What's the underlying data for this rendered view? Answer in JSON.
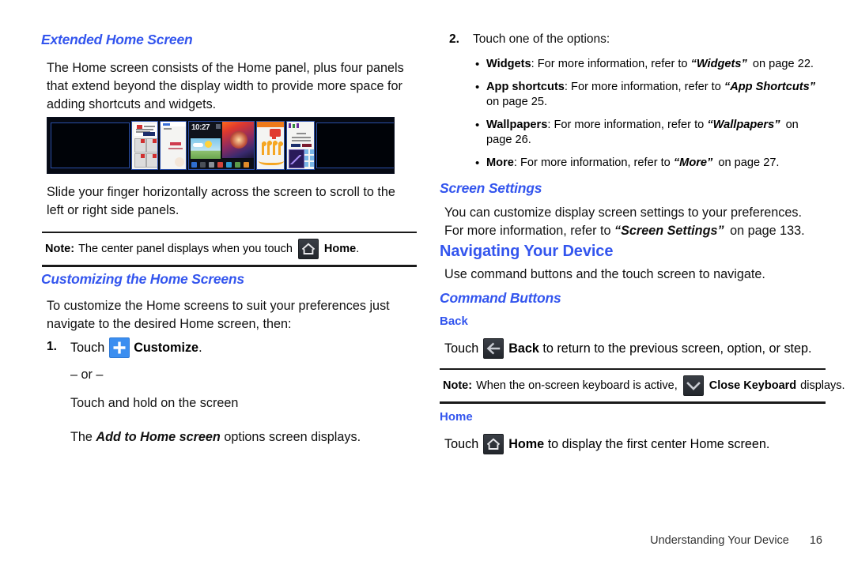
{
  "document": {
    "footer": {
      "section": "Understanding Your Device",
      "page_number": "16"
    },
    "accent_color": "#3355EE",
    "icon_blue": "#3b8ef0",
    "icon_dark": "#2b3036"
  },
  "left_column": {
    "heading_extended": "Extended Home Screen",
    "intro_paragraph": "The Home screen consists of the Home panel, plus four panels that extend beyond the display width to provide more space for adding shortcuts and widgets.",
    "figure_caption_alt": "Five Home screen panels shown side by side",
    "slide_paragraph": "Slide your finger horizontally across the screen to scroll to the left or right side panels.",
    "note_home": {
      "label": "Note:",
      "text_before": "The center panel displays when you touch",
      "icon": "home-icon",
      "bold_after": "Home",
      "text_end": "."
    },
    "heading_customizing": "Customizing the Home Screens",
    "customize_paragraph": "To customize the Home screens to suit your preferences just navigate to the desired Home screen, then:",
    "step_one": {
      "number": "1.",
      "touch_word": "Touch",
      "icon": "plus-icon",
      "bold_label": "Customize",
      "period": ".",
      "or_line": "– or –",
      "alt_line": "Touch and hold on the screen",
      "result_prefix": "The",
      "result_bold": "Add to Home screen",
      "result_suffix": "options screen displays."
    }
  },
  "right_column": {
    "step_two": {
      "number": "2.",
      "text": "Touch one of the options:",
      "options": [
        {
          "name": "Widgets",
          "sep": ":",
          "body": "For more information, refer to",
          "ref": "“Widgets”",
          "tail": "on page 22."
        },
        {
          "name": "App shortcuts",
          "sep": ":",
          "body": "For more information, refer to",
          "ref": "“App Shortcuts”",
          "tail": "on page 25."
        },
        {
          "name": "Wallpapers",
          "sep": ":",
          "body": "For more information, refer to",
          "ref": "“Wallpapers”",
          "tail": "on page 26."
        },
        {
          "name": "More",
          "sep": ":",
          "body": "For more information, refer to",
          "ref": "“More”",
          "tail": "on page 27."
        }
      ]
    },
    "heading_screen_settings": "Screen Settings",
    "screen_settings_text_1": "You can customize display screen settings to your preferences. For more information, refer to",
    "screen_settings_ref": "“Screen Settings”",
    "screen_settings_text_2": "on page 133.",
    "heading_navigating": "Navigating Your Device",
    "navigating_paragraph": "Use command buttons and the touch screen to navigate.",
    "heading_command_buttons": "Command Buttons",
    "heading_back": "Back",
    "back_line": {
      "touch_word": "Touch",
      "icon": "back-arrow-icon",
      "bold_label": "Back",
      "rest": "to return to the previous screen, option, or step."
    },
    "note_keyboard": {
      "label": "Note:",
      "text_before": "When the on-screen keyboard is active,",
      "icon": "close-keyboard-icon",
      "bold_after": "Close Keyboard",
      "text_end": "displays."
    },
    "heading_home": "Home",
    "home_line": {
      "touch_word": "Touch",
      "icon": "home-icon",
      "bold_label": "Home",
      "rest": "to display the first center Home screen."
    }
  }
}
